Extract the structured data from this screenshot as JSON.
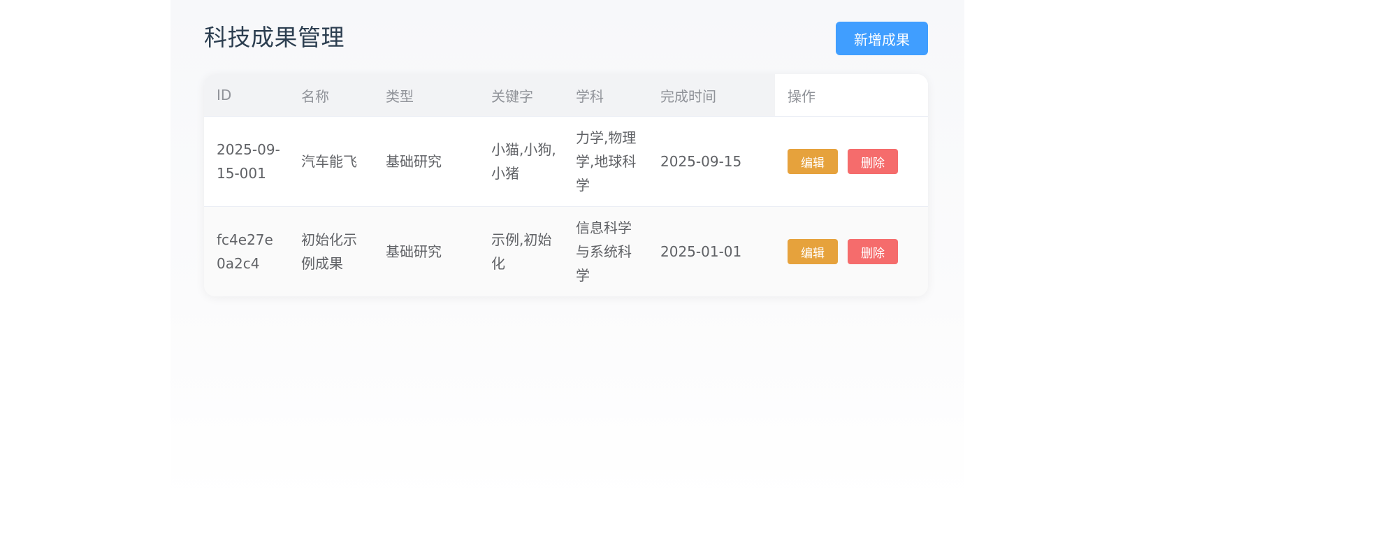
{
  "header": {
    "title": "科技成果管理",
    "add_button_label": "新增成果"
  },
  "table": {
    "columns": [
      "ID",
      "名称",
      "类型",
      "关键字",
      "学科",
      "完成时间",
      "操作"
    ],
    "rows": [
      {
        "id": "2025-09-15-001",
        "name": "汽车能飞",
        "type": "基础研究",
        "keywords": "小猫,小狗,小猪",
        "subject": "力学,物理学,地球科学",
        "date": "2025-09-15",
        "edit_label": "编辑",
        "delete_label": "删除"
      },
      {
        "id": "fc4e27e0a2c4",
        "name": "初始化示例成果",
        "type": "基础研究",
        "keywords": "示例,初始化",
        "subject": "信息科学与系统科学",
        "date": "2025-01-01",
        "edit_label": "编辑",
        "delete_label": "删除"
      }
    ]
  },
  "colors": {
    "primary": "#409eff",
    "warning": "#e6a23c",
    "danger": "#f56c6c"
  }
}
